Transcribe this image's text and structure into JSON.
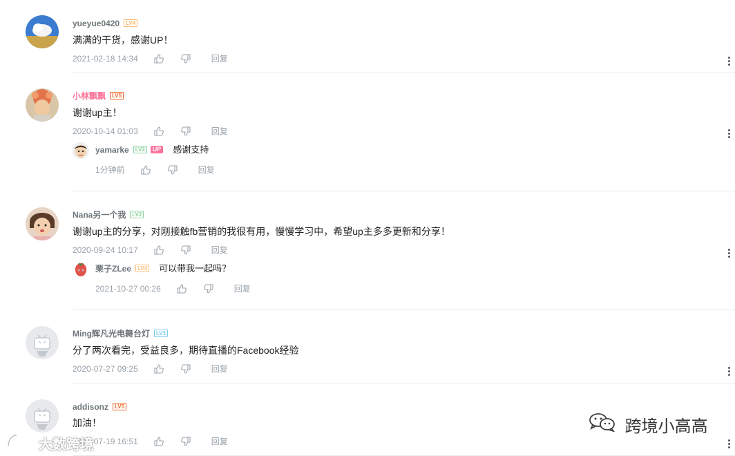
{
  "comments": [
    {
      "username": "yueyue0420",
      "level": "LV4",
      "text": "满满的干货，感谢UP！",
      "time": "2021-02-18 14:34",
      "reply_label": "回复"
    },
    {
      "username": "小林飘飘",
      "level": "LV5",
      "text": "谢谢up主！",
      "time": "2020-10-14 01:03",
      "reply_label": "回复",
      "replies": [
        {
          "username": "yamarke",
          "level": "LV2",
          "badge": "UP",
          "text": "感谢支持",
          "time": "1分钟前",
          "reply_label": "回复"
        }
      ]
    },
    {
      "username": "Nana另一个我",
      "level": "LV2",
      "text": "谢谢up主的分享，对刚接触fb营销的我很有用，慢慢学习中，希望up主多多更新和分享！",
      "time": "2020-09-24 10:17",
      "reply_label": "回复",
      "replies": [
        {
          "username": "栗子ZLee",
          "level": "LV4",
          "text": "可以带我一起吗？",
          "time": "2021-10-27 00:26",
          "reply_label": "回复"
        }
      ]
    },
    {
      "username": "Ming辉凡光电舞台灯",
      "level": "LV3",
      "text": "分了两次看完，受益良多，期待直播的Facebook经验",
      "time": "2020-07-27 09:25",
      "reply_label": "回复"
    },
    {
      "username": "addisonz",
      "level": "LV5",
      "text": "加油！",
      "time": "2020-07-19 16:51",
      "reply_label": "回复"
    }
  ],
  "watermarks": {
    "right": "跨境小高高",
    "left": "大数跨境"
  },
  "colors": {
    "pink_name": "#fb7299",
    "meta_gray": "#99a2aa",
    "divider": "#e5e9ef"
  }
}
